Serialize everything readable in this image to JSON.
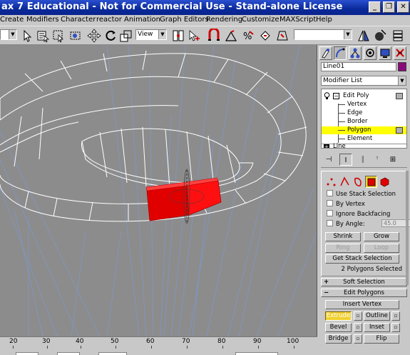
{
  "window": {
    "title": "ax 7  Educational - Not for Commercial Use - Stand-alone License",
    "minimize": "_",
    "restore": "❐",
    "close": "✕"
  },
  "menu": [
    "Create",
    "Modifiers",
    "Character",
    "reactor",
    "Animation",
    "Graph Editors",
    "Rendering",
    "Customize",
    "MAXScript",
    "Help"
  ],
  "toolbar": {
    "coord_system": "View"
  },
  "ruler": {
    "labels": [
      "20",
      "30",
      "40",
      "50",
      "60",
      "70",
      "80",
      "90",
      "100"
    ]
  },
  "panel": {
    "object_name": "Line01",
    "object_color": "#8a0a7a",
    "modifier_list": "Modifier List",
    "stack": [
      {
        "label": "Edit Poly",
        "level": 0
      },
      {
        "label": "Vertex",
        "level": 1
      },
      {
        "label": "Edge",
        "level": 1
      },
      {
        "label": "Border",
        "level": 1
      },
      {
        "label": "Polygon",
        "level": 1,
        "selected": true
      },
      {
        "label": "Element",
        "level": 1
      },
      {
        "label": "Line",
        "level": 0
      }
    ],
    "selection": {
      "use_stack_selection": "Use Stack Selection",
      "by_vertex": "By Vertex",
      "ignore_backfacing": "Ignore Backfacing",
      "by_angle": "By Angle:",
      "angle_value": "45.0",
      "shrink": "Shrink",
      "grow": "Grow",
      "ring": "Ring",
      "loop": "Loop",
      "get_stack_selection": "Get Stack Selection",
      "status": "2 Polygons Selected"
    },
    "soft_selection": "Soft Selection",
    "edit_polygons": {
      "title": "Edit Polygons",
      "insert_vertex": "Insert Vertex",
      "extrude": "Extrude",
      "outline": "Outline",
      "bevel": "Bevel",
      "inset": "Inset",
      "bridge": "Bridge",
      "flip": "Flip"
    }
  },
  "colors": {
    "title_bar": "#0a248e",
    "selected_polygon": "#ff0000",
    "viewport_bg": "#8c8c8c",
    "wireframe": "#ffffff",
    "stack_highlight": "#ffff00"
  }
}
